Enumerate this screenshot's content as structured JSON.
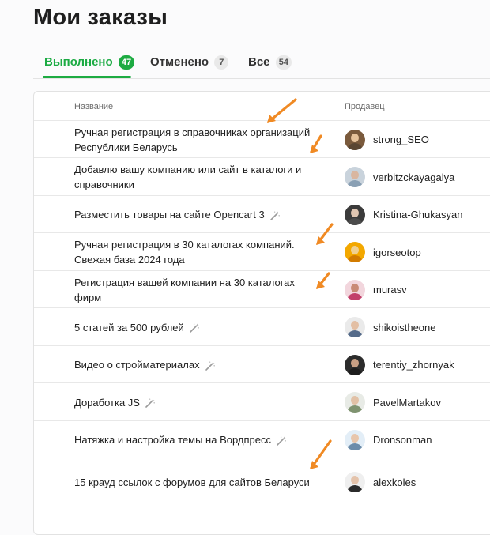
{
  "page": {
    "title": "Мои заказы"
  },
  "tabs": [
    {
      "label": "Выполнено",
      "count": "47",
      "active": true
    },
    {
      "label": "Отменено",
      "count": "7",
      "active": false
    },
    {
      "label": "Все",
      "count": "54",
      "active": false
    }
  ],
  "table": {
    "headers": {
      "name": "Название",
      "seller": "Продавец"
    },
    "rows": [
      {
        "title": "Ручная регистрация в справочниках организаций Республики Беларусь",
        "seller": "strong_SEO",
        "wand": false,
        "arrow": true
      },
      {
        "title": "Добавлю вашу компанию или сайт в каталоги и справочники",
        "seller": "verbitzckayagalya",
        "wand": false,
        "arrow": true
      },
      {
        "title": "Разместить товары на сайте Opencart 3",
        "seller": "Kristina-Ghukasyan",
        "wand": true,
        "arrow": false
      },
      {
        "title": "Ручная регистрация в 30 каталогах компаний. Свежая база 2024 года",
        "seller": "igorseotop",
        "wand": false,
        "arrow": true
      },
      {
        "title": "Регистрация вашей компании на 30 каталогах фирм",
        "seller": "murasv",
        "wand": false,
        "arrow": true
      },
      {
        "title": "5 статей за 500 рублей",
        "seller": "shikoistheone",
        "wand": true,
        "arrow": false
      },
      {
        "title": "Видео о стройматериалах",
        "seller": "terentiy_zhornyak",
        "wand": true,
        "arrow": false
      },
      {
        "title": "Доработка JS",
        "seller": "PavelMartakov",
        "wand": true,
        "arrow": false
      },
      {
        "title": "Натяжка и настройка темы на Вордпресс",
        "seller": "Dronsonman",
        "wand": true,
        "arrow": false
      },
      {
        "title": "15 крауд ссылок с форумов для сайтов Беларуси",
        "seller": "alexkoles",
        "wand": false,
        "arrow": true
      }
    ]
  },
  "colors": {
    "accent": "#1dab42",
    "annotation_arrow": "#f08a24"
  },
  "icons": {
    "row_badge": "magic-wand-icon",
    "annotation": "arrow-annotation-icon"
  }
}
